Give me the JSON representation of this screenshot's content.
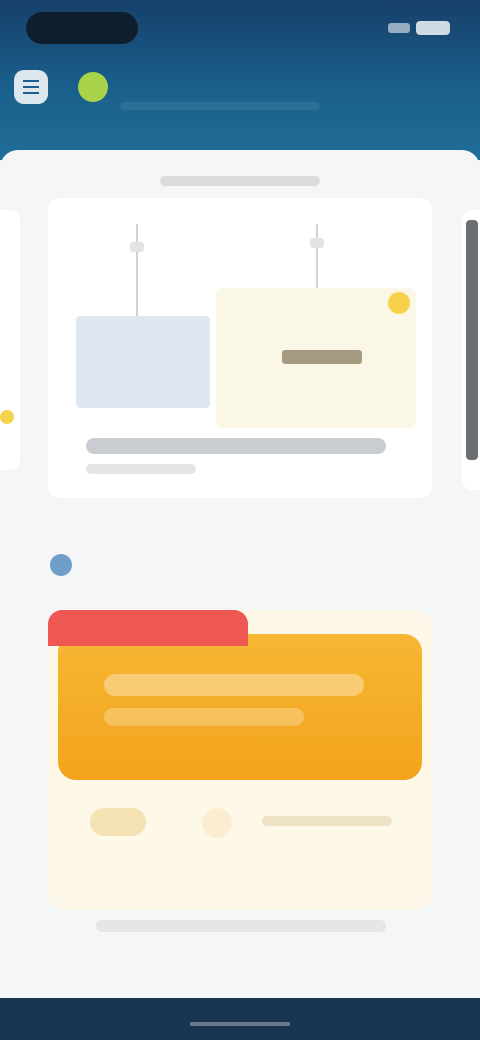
{
  "header": {
    "brand_name": "",
    "colors": {
      "header_top": "#16406a",
      "header_bottom": "#1f6e98",
      "brand_icon": "#a8d24a"
    }
  },
  "carousel": {
    "title": "",
    "caption": ""
  },
  "promo": {
    "tab_label": "",
    "colors": {
      "tab": "#ef5753",
      "card": "#f3a31c",
      "background": "#fdf8e8"
    }
  },
  "icons": {
    "menu": "menu-icon",
    "brand": "brand-icon",
    "section": "section-icon"
  }
}
